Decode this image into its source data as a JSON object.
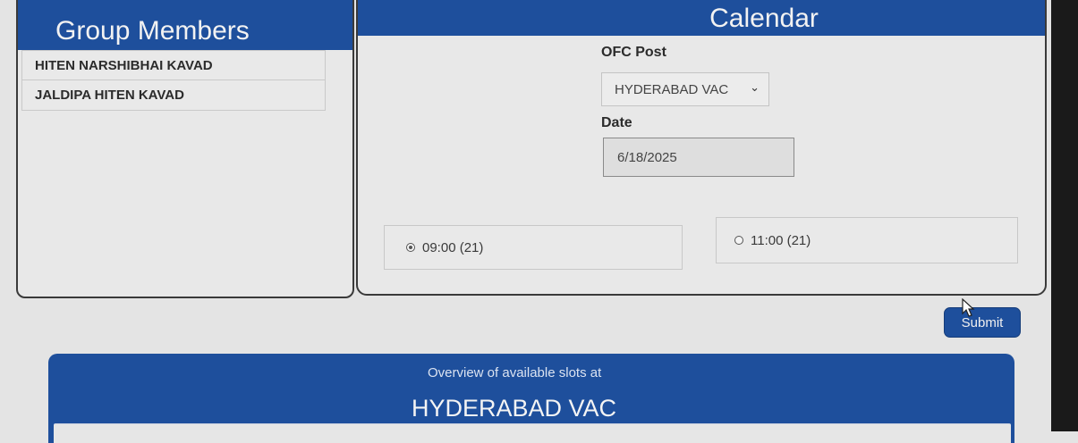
{
  "members": {
    "title": "Group Members",
    "items": [
      {
        "name": "HITEN NARSHIBHAI KAVAD"
      },
      {
        "name": "JALDIPA HITEN KAVAD"
      }
    ]
  },
  "calendar": {
    "title": "Calendar",
    "ofc_post_label": "OFC Post",
    "ofc_post_value": "HYDERABAD VAC",
    "date_label": "Date",
    "date_value": "6/18/2025",
    "slots": [
      {
        "label": "09:00 (21)",
        "selected": true
      },
      {
        "label": "11:00 (21)",
        "selected": false
      }
    ]
  },
  "actions": {
    "submit_label": "Submit"
  },
  "overview": {
    "caption": "Overview of available slots at",
    "location": "HYDERABAD VAC"
  },
  "colors": {
    "brand": "#1e4f9c",
    "panel_bg": "#e8e8e8"
  }
}
